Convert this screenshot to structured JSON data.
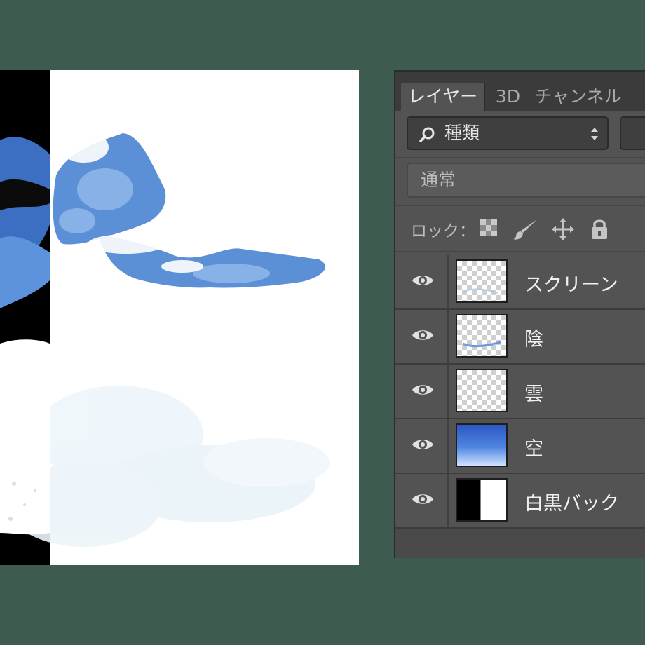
{
  "panel": {
    "tabs": [
      {
        "label": "レイヤー",
        "active": true
      },
      {
        "label": "3D",
        "active": false
      },
      {
        "label": "チャンネル",
        "active": false
      }
    ],
    "kind_filter": {
      "label": "種類",
      "icon": "search-icon"
    },
    "blend_mode": "通常",
    "lock_label": "ロック：",
    "lock_icons": [
      "lock-transparent-pixels-icon",
      "lock-image-pixels-icon",
      "lock-position-icon",
      "lock-all-icon"
    ]
  },
  "layers": [
    {
      "name": "スクリーン",
      "thumbnail": "transparent",
      "visible": true
    },
    {
      "name": "陰",
      "thumbnail": "transparent",
      "visible": true
    },
    {
      "name": "雲",
      "thumbnail": "transparent",
      "visible": true
    },
    {
      "name": "空",
      "thumbnail": "blue-gradient",
      "visible": true
    },
    {
      "name": "白黒バック",
      "thumbnail": "black-white-split",
      "visible": true
    }
  ],
  "colors": {
    "background": "#3d5c4f",
    "panel": "#535353",
    "sky_blue": "#4f86e0"
  }
}
